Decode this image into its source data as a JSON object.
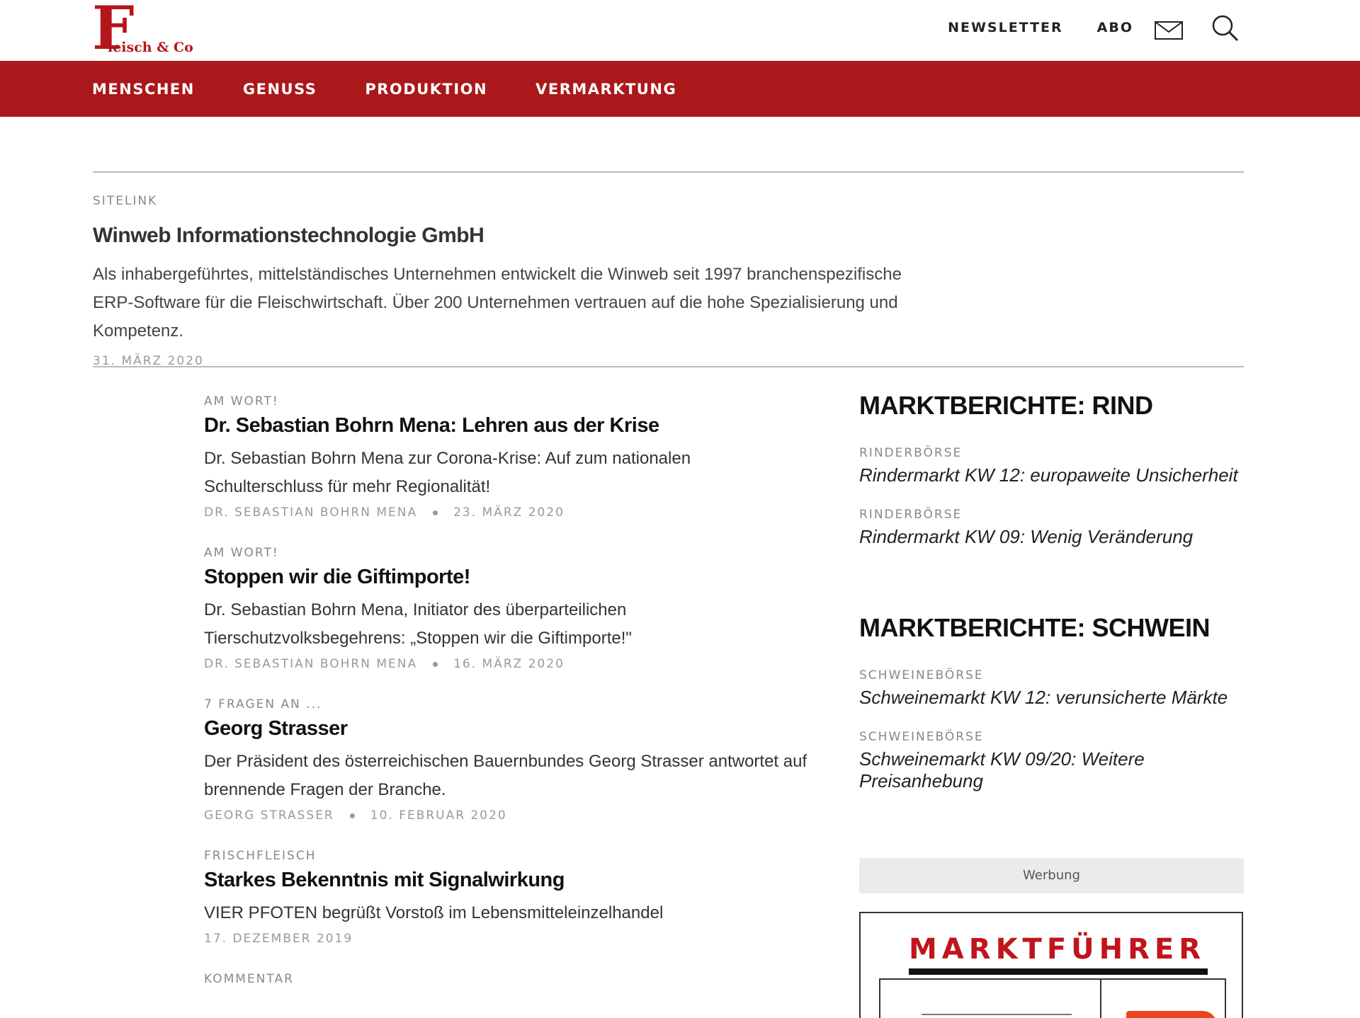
{
  "header": {
    "logo": {
      "letter": "F",
      "text": "leisch & Co"
    },
    "links": [
      {
        "label": "NEWSLETTER"
      },
      {
        "label": "ABO"
      }
    ]
  },
  "nav": {
    "items": [
      {
        "label": "MENSCHEN"
      },
      {
        "label": "GENUSS"
      },
      {
        "label": "PRODUKTION"
      },
      {
        "label": "VERMARKTUNG"
      }
    ]
  },
  "sitelink": {
    "kicker": "SITELINK",
    "title": "Winweb Informationstechnologie GmbH",
    "text": "Als inhabergeführtes, mittelständisches Unternehmen entwickelt die Winweb seit 1997 branchenspezifische ERP-Software für die Fleischwirtschaft. Über 200 Unternehmen vertrauen auf die hohe Spezialisierung und Kompetenz.",
    "date": "31. MÄRZ 2020"
  },
  "articles": [
    {
      "kicker": "AM WORT!",
      "title": "Dr. Sebastian Bohrn Mena: Lehren aus der Krise",
      "text": "Dr. Sebastian Bohrn Mena zur Corona-Krise: Auf zum nationalen Schulterschluss für mehr Regionalität!",
      "author": "DR. SEBASTIAN BOHRN MENA",
      "date": "23. MÄRZ 2020"
    },
    {
      "kicker": "AM WORT!",
      "title": "Stoppen wir die Giftimporte!",
      "text": "Dr. Sebastian Bohrn Mena, Initiator des überparteilichen Tierschutzvolksbegehrens: „Stoppen wir die Giftimporte!\"",
      "author": "DR. SEBASTIAN BOHRN MENA",
      "date": "16. MÄRZ 2020"
    },
    {
      "kicker": "7 FRAGEN AN ...",
      "title": "Georg Strasser",
      "text": "Der Präsident des österreichischen Bauernbundes Georg Strasser antwortet auf brennende Fragen der Branche.",
      "author": "GEORG STRASSER",
      "date": "10. FEBRUAR 2020"
    },
    {
      "kicker": "FRISCHFLEISCH",
      "title": "Starkes Bekenntnis mit Signalwirkung",
      "text": "VIER PFOTEN begrüßt Vorstoß im Lebensmitteleinzelhandel",
      "date": "17. DEZEMBER 2019"
    },
    {
      "kicker": "KOMMENTAR"
    }
  ],
  "sidebar": {
    "rind": {
      "heading": "MARKTBERICHTE: RIND",
      "items": [
        {
          "kicker": "RINDERBÖRSE",
          "link": "Rindermarkt KW 12: europaweite Unsicherheit"
        },
        {
          "kicker": "RINDERBÖRSE",
          "link": "Rindermarkt KW 09: Wenig Veränderung"
        }
      ]
    },
    "schwein": {
      "heading": "MARKTBERICHTE: SCHWEIN",
      "items": [
        {
          "kicker": "SCHWEINEBÖRSE",
          "link": "Schweinemarkt KW 12: verunsicherte Märkte"
        },
        {
          "kicker": "SCHWEINEBÖRSE",
          "link": "Schweinemarkt KW 09/20: Weitere Preisanhebung"
        }
      ]
    },
    "ad_label": "Werbung",
    "ad_title": "MARKTFÜHRER"
  },
  "colors": {
    "brand_red": "#aa181b",
    "logo_red": "#b5161b"
  }
}
